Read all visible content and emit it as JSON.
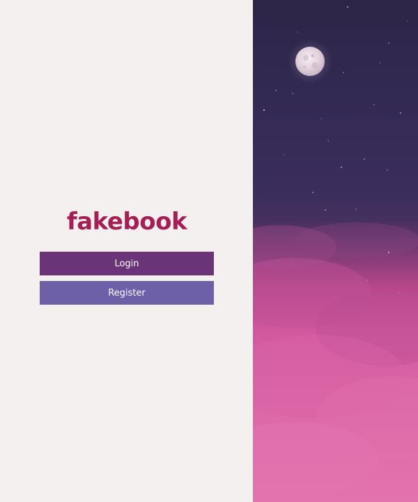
{
  "brand": {
    "logo_text": "fakebook",
    "logo_color": "#a51f55"
  },
  "auth": {
    "login_label": "Login",
    "register_label": "Register",
    "login_color": "#6b3478",
    "register_color": "#6e5fa9"
  },
  "background": {
    "description_icon": "night-sky-moon-icon"
  }
}
